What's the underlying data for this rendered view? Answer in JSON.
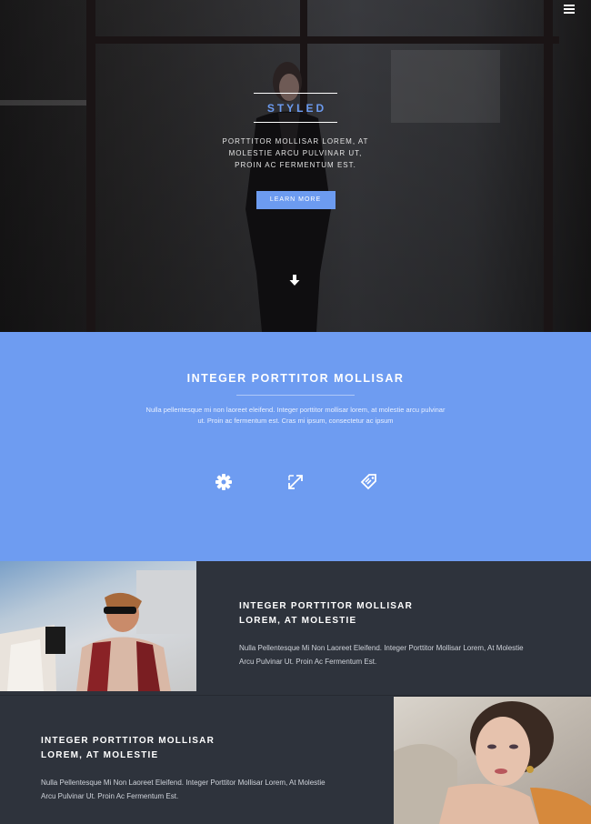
{
  "hero": {
    "title": "STYLED",
    "text": "PORTTITOR MOLLISAR LOREM, AT MOLESTIE ARCU PULVINAR UT, PROIN AC FERMENTUM EST.",
    "button_label": "LEARN MORE",
    "menu_icon": "hamburger-icon",
    "scroll_icon": "arrow-down-icon"
  },
  "intro": {
    "title": "INTEGER PORTTITOR MOLLISAR",
    "text": "Nulla pellentesque mi non laoreet eleifend. Integer porttitor mollisar lorem, at molestie arcu pulvinar ut. Proin ac fermentum est. Cras mi ipsum, consectetur ac ipsum",
    "icons": [
      "gear-icon",
      "resize-icon",
      "tags-icon"
    ]
  },
  "feature1": {
    "title_line1": "INTEGER PORTTITOR MOLLISAR",
    "title_line2": "LOREM, AT MOLESTIE",
    "text": "Nulla Pellentesque Mi Non Laoreet Eleifend. Integer Porttitor Mollisar Lorem, At Molestie Arcu Pulvinar Ut. Proin Ac Fermentum Est."
  },
  "feature2": {
    "title_line1": "INTEGER PORTTITOR MOLLISAR",
    "title_line2": "LOREM, AT MOLESTIE",
    "text": "Nulla Pellentesque Mi Non Laoreet Eleifend. Integer Porttitor Mollisar Lorem, At Molestie Arcu Pulvinar Ut. Proin Ac Fermentum Est."
  },
  "colors": {
    "accent": "#6c9bf0",
    "section_blue": "#6e9cf1",
    "dark": "#2e333c"
  }
}
